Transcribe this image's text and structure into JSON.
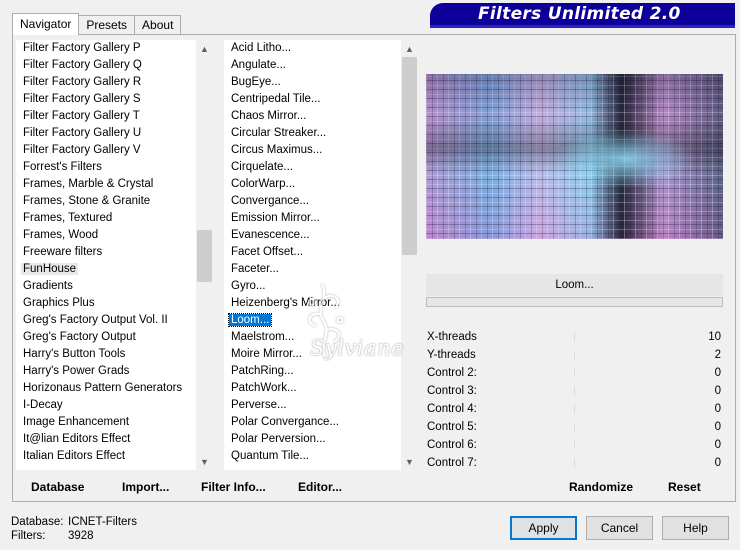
{
  "tabs": [
    {
      "label": "Navigator",
      "active": true
    },
    {
      "label": "Presets",
      "active": false
    },
    {
      "label": "About",
      "active": false
    }
  ],
  "title": "Filters Unlimited 2.0",
  "categories": {
    "items": [
      "Filter Factory Gallery P",
      "Filter Factory Gallery Q",
      "Filter Factory Gallery R",
      "Filter Factory Gallery S",
      "Filter Factory Gallery T",
      "Filter Factory Gallery U",
      "Filter Factory Gallery V",
      "Forrest's Filters",
      "Frames, Marble & Crystal",
      "Frames, Stone & Granite",
      "Frames, Textured",
      "Frames, Wood",
      "Freeware filters",
      "FunHouse",
      "Gradients",
      "Graphics Plus",
      "Greg's Factory Output Vol. II",
      "Greg's Factory Output",
      "Harry's Button Tools",
      "Harry's Power Grads",
      "Horizonaus Pattern Generators",
      "I-Decay",
      "Image Enhancement",
      "It@lian Editors Effect",
      "Italian Editors Effect"
    ],
    "selected": "FunHouse"
  },
  "filters": {
    "items": [
      "Acid Litho...",
      "Angulate...",
      "BugEye...",
      "Centripedal Tile...",
      "Chaos Mirror...",
      "Circular Streaker...",
      "Circus Maximus...",
      "Cirquelate...",
      "ColorWarp...",
      "Convergance...",
      "Emission Mirror...",
      "Evanescence...",
      "Facet Offset...",
      "Faceter...",
      "Gyro...",
      "Heizenberg's Mirror...",
      "Loom...",
      "Maelstrom...",
      "Moire Mirror...",
      "PatchRing...",
      "PatchWork...",
      "Perverse...",
      "Polar Convergance...",
      "Polar Perversion...",
      "Quantum Tile..."
    ],
    "selected": "Loom..."
  },
  "current_filter": "Loom...",
  "progress": 0,
  "controls": [
    {
      "label": "X-threads",
      "value": "10"
    },
    {
      "label": "Y-threads",
      "value": "2"
    },
    {
      "label": "Control 2:",
      "value": "0"
    },
    {
      "label": "Control 3:",
      "value": "0"
    },
    {
      "label": "Control 4:",
      "value": "0"
    },
    {
      "label": "Control 5:",
      "value": "0"
    },
    {
      "label": "Control 6:",
      "value": "0"
    },
    {
      "label": "Control 7:",
      "value": "0"
    }
  ],
  "toolbar": {
    "database": "Database",
    "import": "Import...",
    "filter_info": "Filter Info...",
    "editor": "Editor...",
    "randomize": "Randomize",
    "reset": "Reset"
  },
  "info": {
    "database_label": "Database:",
    "database_value": "ICNET-Filters",
    "filters_label": "Filters:",
    "filters_value": "3928"
  },
  "buttons": {
    "apply": "Apply",
    "cancel": "Cancel",
    "help": "Help"
  },
  "watermark": "Sylviane"
}
